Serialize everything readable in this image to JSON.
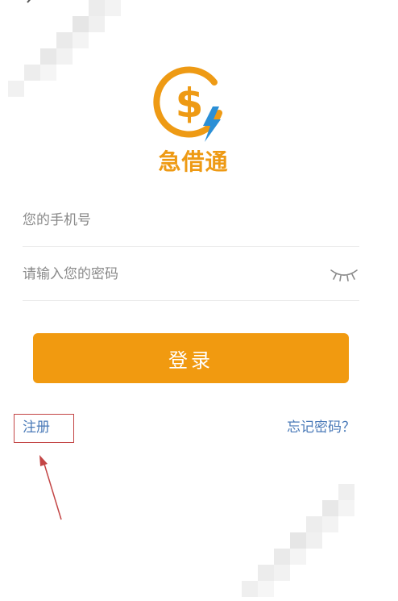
{
  "brand": {
    "name": "急借通",
    "logo_symbol": "$",
    "colors": {
      "orange": "#ee9a14",
      "bolt_blue": "#2b8fd6"
    }
  },
  "form": {
    "phone_placeholder": "您的手机号",
    "password_placeholder": "请输入您的密码",
    "login_label": "登录",
    "login_color": "#f19a10"
  },
  "links": {
    "register_label": "注册",
    "forgot_label": "忘记密码？",
    "link_color": "#4a7ab8"
  },
  "icons": {
    "back": "chevron-left-icon",
    "password_toggle": "eye-closed-icon",
    "logo": "dollar-bolt-icon"
  }
}
